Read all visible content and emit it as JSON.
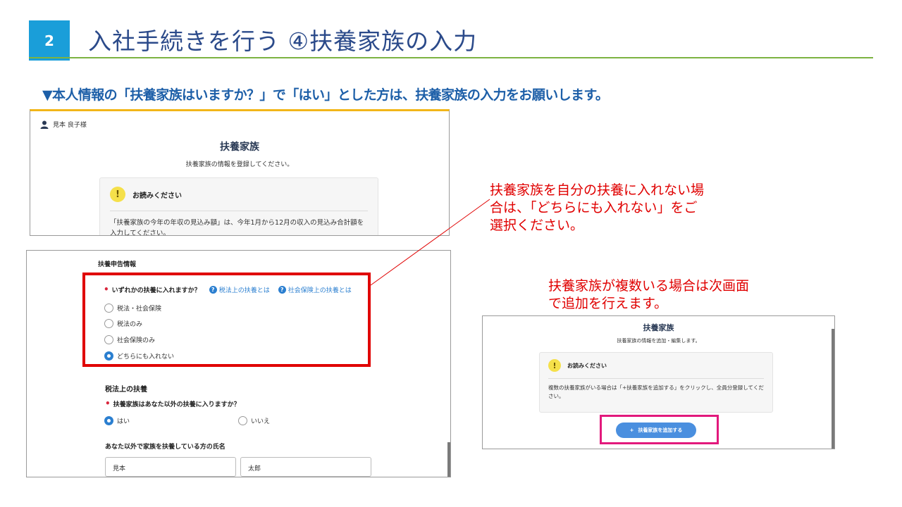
{
  "header": {
    "step": "2",
    "title": "入社手続きを行う ④扶養家族の入力",
    "subtitle": "▼本人情報の「扶養家族はいますか？」で「はい」とした方は、扶養家族の入力をお願いします。"
  },
  "panel1": {
    "user_name": "見本 良子様",
    "heading": "扶養家族",
    "description": "扶養家族の情報を登録してください。",
    "notice_title": "お読みください",
    "notice_body": "「扶養家族の今年の年収の見込み額」は、今年1月から12月の収入の見込み合計額を入力してください。"
  },
  "panel2": {
    "section_title": "扶養申告情報",
    "question1": "いずれかの扶養に入れますか？",
    "help1": "税法上の扶養とは",
    "help2": "社会保険上の扶養とは",
    "options": [
      {
        "label": "税法・社会保険",
        "selected": false
      },
      {
        "label": "税法のみ",
        "selected": false
      },
      {
        "label": "社会保険のみ",
        "selected": false
      },
      {
        "label": "どちらにも入れない",
        "selected": true
      }
    ],
    "tax_section": "税法上の扶養",
    "question2": "扶養家族はあなた以外の扶養に入りますか？",
    "yes_label": "はい",
    "no_label": "いいえ",
    "yes_selected": true,
    "name_label": "あなた以外で家族を扶養している方の氏名",
    "last_name": "見本",
    "first_name": "太郎"
  },
  "panel3": {
    "heading": "扶養家族",
    "description": "扶養家族の情報を追加・編集します。",
    "notice_title": "お読みください",
    "notice_body": "複数の扶養家族がいる場合は「+扶養家族を追加する」をクリックし、全員分登録してください。",
    "add_button": "扶養家族を追加する",
    "add_button_icon": "+"
  },
  "callouts": {
    "callout1": "扶養家族を自分の扶養に入れない場合は、「どちらにも入れない」をご選択ください。",
    "callout2": "扶養家族が複数いる場合は次画面で追加を行えます。"
  },
  "colors": {
    "badge": "#1a9ed9",
    "title": "#2b4a8a",
    "rule": "#7cb342",
    "subtitle": "#1d5fa8",
    "callout_red": "#e00000",
    "highlight_pink": "#e2197c",
    "accent_yellow": "#f2b619",
    "primary_blue": "#2b7fd0"
  }
}
